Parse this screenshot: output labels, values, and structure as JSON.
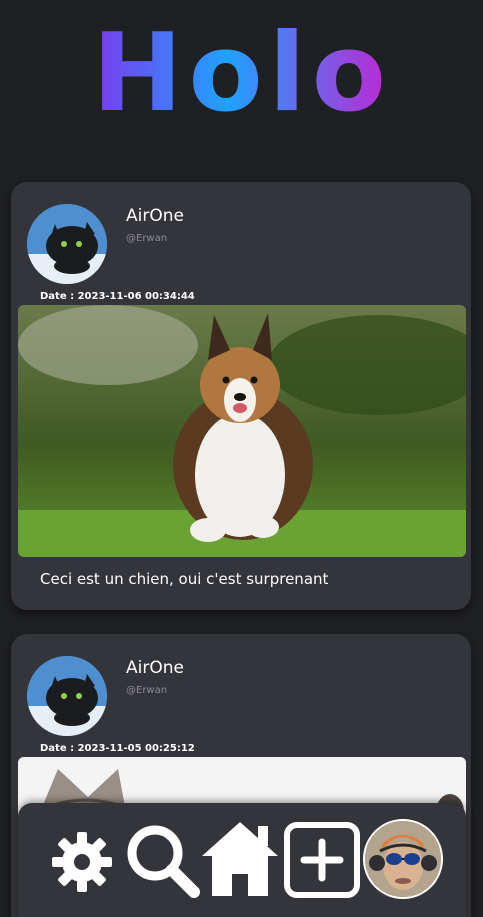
{
  "app": {
    "title": "Holo",
    "brand_gradient": [
      "#7c3aed",
      "#1fa2ff",
      "#c026d3"
    ],
    "background": "#1f2024",
    "card_background": "#34353b"
  },
  "feed": {
    "posts": [
      {
        "username": "AirOne",
        "handle": "@Erwan",
        "date": "Date : 2023-11-06 00:34:44",
        "caption": "Ceci est un chien, oui c'est surprenant",
        "image": "photo-shetland-sheepdog-running"
      },
      {
        "username": "AirOne",
        "handle": "@Erwan",
        "date": "Date : 2023-11-05 00:25:12",
        "caption": "",
        "image": "photo-cat"
      }
    ]
  },
  "nav": {
    "items": [
      {
        "name": "settings",
        "icon": "gear-icon"
      },
      {
        "name": "search",
        "icon": "search-icon"
      },
      {
        "name": "home",
        "icon": "home-icon"
      },
      {
        "name": "add",
        "icon": "plus-square-icon"
      },
      {
        "name": "profile",
        "icon": "avatar"
      }
    ],
    "icon_color": "#ffffff"
  }
}
